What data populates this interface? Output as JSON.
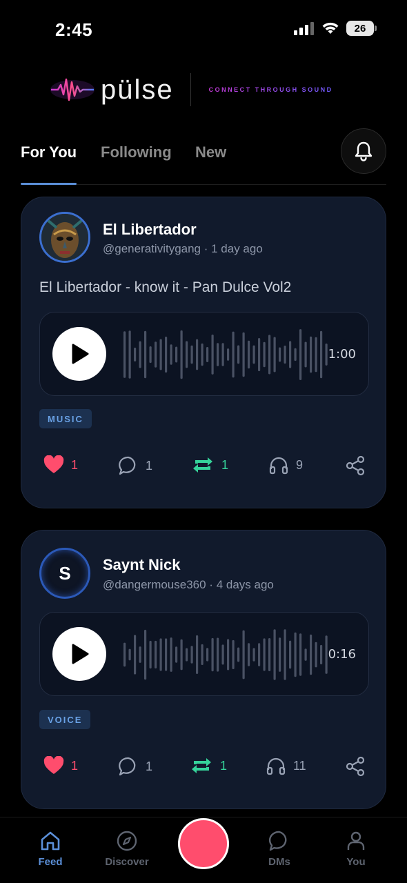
{
  "status": {
    "time": "2:45",
    "battery": "26"
  },
  "brand": {
    "name": "pülse",
    "tagline": "CONNECT THROUGH SOUND"
  },
  "tabs": [
    {
      "label": "For You",
      "active": true
    },
    {
      "label": "Following"
    },
    {
      "label": "New"
    }
  ],
  "posts": [
    {
      "author": "El Libertador",
      "handle": "@generativitygang",
      "time": "1 day ago",
      "meta": "@generativitygang · 1 day ago",
      "caption": "El Libertador - know it - Pan Dulce Vol2",
      "duration": "1:00",
      "tag": "MUSIC",
      "likes": "1",
      "comments": "1",
      "reposts": "1",
      "listens": "9"
    },
    {
      "author": "Saynt Nick",
      "avatar_letter": "S",
      "handle": "@dangermouse360",
      "time": "4 days ago",
      "meta": "@dangermouse360 · 4 days ago",
      "duration": "0:16",
      "tag": "VOICE",
      "likes": "1",
      "comments": "1",
      "reposts": "1",
      "listens": "11"
    }
  ],
  "nav": {
    "feed": "Feed",
    "discover": "Discover",
    "dms": "DMs",
    "you": "You"
  },
  "colors": {
    "accent": "#5b8fd8",
    "like": "#ff4d6d",
    "repost": "#35d39a",
    "card": "#111a2c"
  }
}
